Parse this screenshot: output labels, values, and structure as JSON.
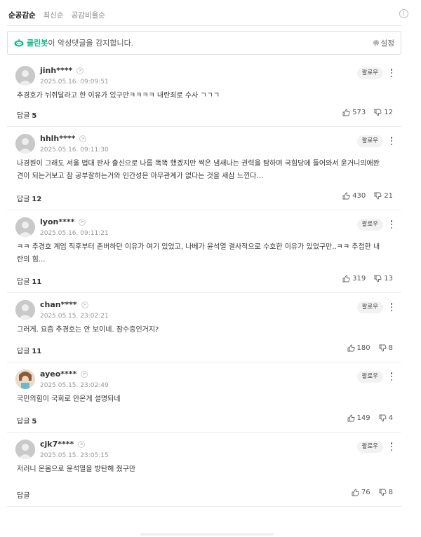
{
  "tabs": [
    {
      "label": "순공감순"
    },
    {
      "label": "최신순"
    },
    {
      "label": "공감비율순"
    }
  ],
  "info_icon": "info-icon",
  "cleanbot": {
    "name": "클린봇",
    "text": "이 악성댓글을 감지합니다.",
    "settings_label": "설정",
    "accent": "#12b886"
  },
  "follow_label": "팔로우",
  "reply_label": "답글",
  "comments": [
    {
      "nick": "jinh****",
      "date": "2025.05.16. 09:09:51",
      "lines": [
        "추경호가 뉘쥐달라고 한 이유가 있구만ㅋㅋㅋㅋ 내란죄로 수사 ㄱㄱㄱ"
      ],
      "reply_count": "5",
      "likes": "573",
      "dislikes": "12",
      "avatar": "default"
    },
    {
      "nick": "hhlh****",
      "date": "2025.05.16. 09:11:30",
      "lines": [
        "나경원이 그래도 서울 법대 판사 출신으로 나름 똑똑 했겠지만 썩은 냄새나는 권력을 탐하며 국힘당에 들어와서 윤거니의애완",
        "견이 되는거보고 참 공부잘하는거와 인간성은 아무관계가 없다는 것을 새삼 느낀다…"
      ],
      "reply_count": "12",
      "likes": "430",
      "dislikes": "21",
      "avatar": "default"
    },
    {
      "nick": "lyon****",
      "date": "2025.05.16. 09:11:21",
      "lines": [
        "ㅋㅋ 추경호 계엄 직후부터 존버하던 이유가 여기 있었고, 나베가 윤석열 결사적으로 수호한 이유가 있었구만..ㅋㅋ 추접한 내",
        "란의 힘..."
      ],
      "reply_count": "11",
      "likes": "319",
      "dislikes": "13",
      "avatar": "default"
    },
    {
      "nick": "chan****",
      "date": "2025.05.15. 23:02:21",
      "lines": [
        "그러게. 요즘 추경호는 안 보이네. 잠수중인거지?"
      ],
      "reply_count": "11",
      "likes": "180",
      "dislikes": "8",
      "avatar": "default"
    },
    {
      "nick": "ayeo****",
      "date": "2025.05.15. 23:02:49",
      "lines": [
        "국민의힘이 국회로 안온게 설명되네"
      ],
      "reply_count": "5",
      "likes": "149",
      "dislikes": "4",
      "avatar": "photo"
    },
    {
      "nick": "cjk7****",
      "date": "2025.05.15. 23:05:15",
      "lines": [
        "저러니 온몸으로 윤석열을 방탄해 줬구만"
      ],
      "reply_count": "",
      "likes": "76",
      "dislikes": "8",
      "avatar": "default"
    }
  ]
}
